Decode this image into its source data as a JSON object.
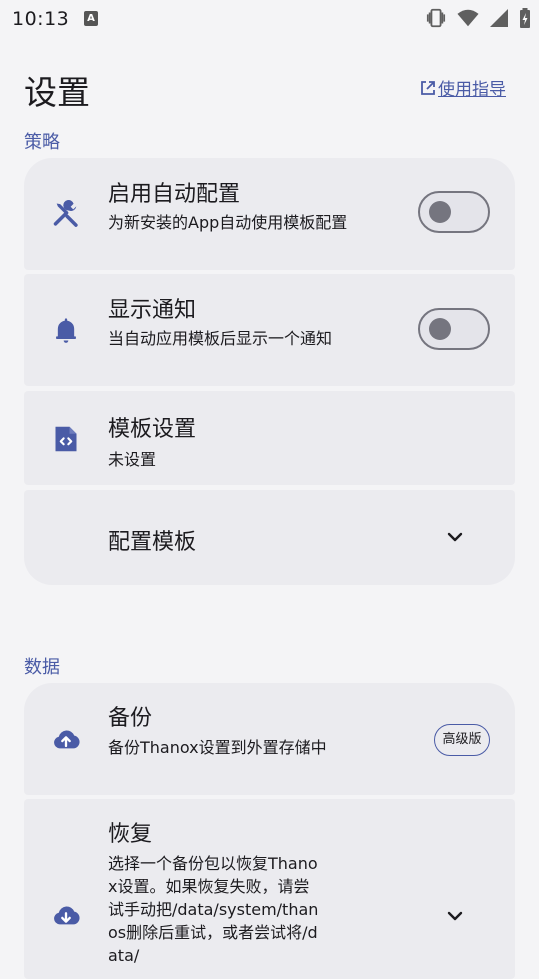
{
  "status_bar": {
    "time": "10:13",
    "notification_glyph": "A"
  },
  "header": {
    "title": "设置",
    "guide_link": "使用指导"
  },
  "sections": {
    "strategy": {
      "label": "策略",
      "items": [
        {
          "title": "启用自动配置",
          "subtitle": "为新安装的App自动使用模板配置",
          "icon": "wrench-screwdriver-icon",
          "control": "toggle",
          "on": false
        },
        {
          "title": "显示通知",
          "subtitle": "当自动应用模板后显示一个通知",
          "icon": "bell-icon",
          "control": "toggle",
          "on": false
        },
        {
          "title": "模板设置",
          "subtitle": "未设置",
          "icon": "code-file-icon"
        },
        {
          "title": "配置模板",
          "control": "chevron"
        }
      ]
    },
    "data": {
      "label": "数据",
      "items": [
        {
          "title": "备份",
          "subtitle": "备份Thanox设置到外置存储中",
          "icon": "cloud-upload-icon",
          "badge": "高级版"
        },
        {
          "title": "恢复",
          "subtitle": "选择一个备份包以恢复Thanox设置。如果恢复失败，请尝试手动把/data/system/thanos删除后重试，或者尝试将/data/",
          "icon": "cloud-download-icon",
          "control": "chevron"
        }
      ]
    }
  },
  "colors": {
    "accent": "#4a5ba6",
    "card": "#ebebef",
    "background": "#f4f4f6",
    "text": "#1c1b1f",
    "toggle_outline": "#75757f"
  }
}
